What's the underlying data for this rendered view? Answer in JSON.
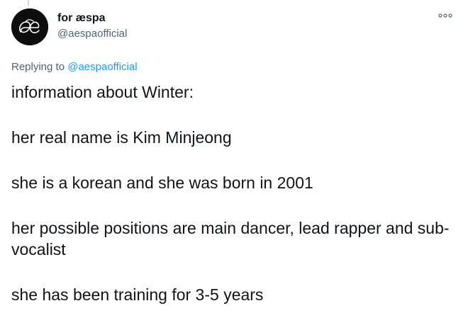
{
  "tweet": {
    "display_name": "for æspa",
    "handle": "@aespaofficial",
    "avatar_icon": "ae-logo",
    "more_icon": "more-options-icon",
    "replying_prefix": "Replying to ",
    "replying_handle": "@aespaofficial",
    "paragraphs": [
      "information about Winter:",
      "her real name is Kim Minjeong",
      "she is a korean and she was born in 2001",
      "her possible positions are main dancer, lead rapper and sub-vocalist",
      "she has been training for 3-5 years"
    ]
  },
  "colors": {
    "text": "#0f1419",
    "secondary": "#536471",
    "link": "#1d9bf0",
    "avatar_bg": "#0d0d0d"
  }
}
